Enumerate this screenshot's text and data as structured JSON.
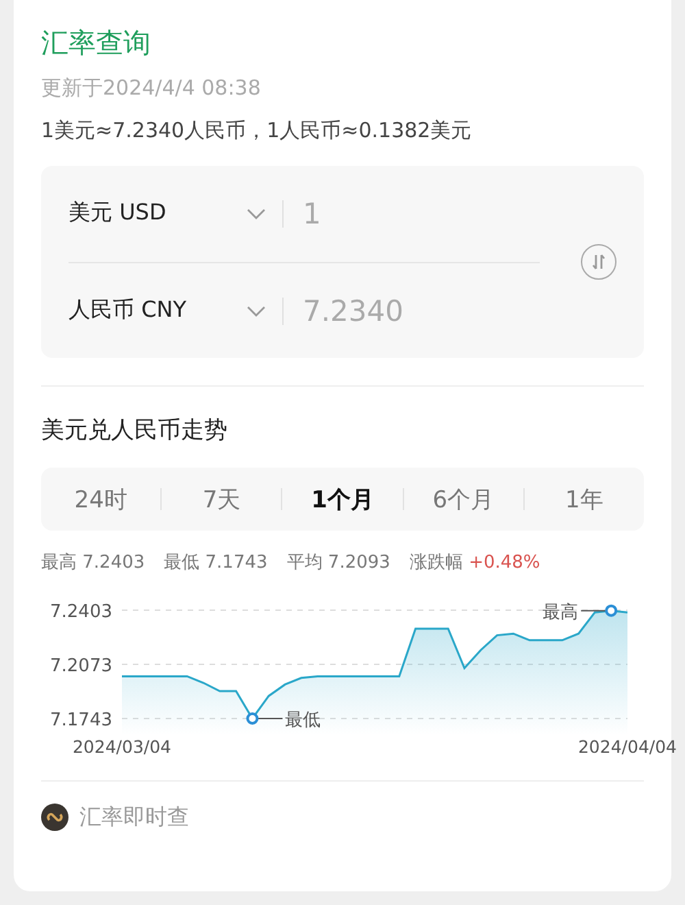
{
  "header": {
    "title": "汇率查询",
    "updated": "更新于2024/4/4 08:38",
    "rate_line": "1美元≈7.2340人民币，1人民币≈0.1382美元"
  },
  "converter": {
    "rows": [
      {
        "currency": "美元 USD",
        "amount": "1"
      },
      {
        "currency": "人民币 CNY",
        "amount": "7.2340"
      }
    ]
  },
  "trend": {
    "title": "美元兑人民币走势",
    "tabs": [
      {
        "label": "24时",
        "selected": false
      },
      {
        "label": "7天",
        "selected": false
      },
      {
        "label": "1个月",
        "selected": true
      },
      {
        "label": "6个月",
        "selected": false
      },
      {
        "label": "1年",
        "selected": false
      }
    ],
    "stats": [
      {
        "label": "最高",
        "value": "7.2403",
        "kind": "plain"
      },
      {
        "label": "最低",
        "value": "7.1743",
        "kind": "plain"
      },
      {
        "label": "平均",
        "value": "7.2093",
        "kind": "plain"
      },
      {
        "label": "涨跌幅",
        "value": "+0.48%",
        "kind": "up"
      }
    ],
    "chart_data": {
      "type": "area",
      "categories": [
        "2024/03/04",
        null,
        null,
        null,
        null,
        null,
        null,
        null,
        null,
        null,
        null,
        null,
        null,
        null,
        null,
        null,
        null,
        null,
        null,
        null,
        null,
        null,
        null,
        null,
        null,
        null,
        null,
        null,
        null,
        null,
        null,
        "2024/04/04"
      ],
      "series": [
        {
          "color": "#2aa7c9",
          "values": [
            7.2,
            7.2,
            7.2,
            7.2,
            7.2,
            7.196,
            7.191,
            7.191,
            7.1743,
            7.188,
            7.195,
            7.199,
            7.2,
            7.2,
            7.2,
            7.2,
            7.2,
            7.2,
            7.229,
            7.229,
            7.229,
            7.205,
            7.216,
            7.225,
            7.226,
            7.222,
            7.222,
            7.222,
            7.226,
            7.239,
            7.24,
            7.239
          ]
        }
      ],
      "ylim": [
        7.1743,
        7.2403
      ],
      "yticks": [
        7.1743,
        7.2073,
        7.2403
      ],
      "annotations": [
        "最高",
        "最低"
      ]
    }
  },
  "footer": {
    "label": "汇率即时查"
  }
}
